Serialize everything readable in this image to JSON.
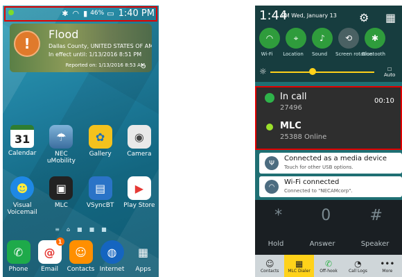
{
  "left_phone": {
    "status": {
      "battery": "46%",
      "time": "1:40 PM",
      "signal_icons": [
        "bluetooth-icon",
        "wifi-icon",
        "signal-icon",
        "battery-icon"
      ]
    },
    "weather": {
      "title": "Flood",
      "location": "Dallas County, UNITED STATES OF AMERICA",
      "in_effect": "In effect until: 1/13/2016 8:51 PM",
      "reported": "Reported on: 1/13/2016 8:53 AM"
    },
    "apps_row1": [
      "Calendar",
      "NEC uMobility",
      "Gallery",
      "Camera"
    ],
    "apps_row2": [
      "Visual Voicemail",
      "MLC",
      "VSyncBT",
      "Play Store"
    ],
    "dock": [
      "Phone",
      "Email",
      "Contacts",
      "Internet",
      "Apps"
    ],
    "calendar_day": "31",
    "email_badge": "1"
  },
  "right_phone": {
    "header": {
      "time": "1:44",
      "ampm": "PM",
      "date": "Wed, January 13"
    },
    "toggles": [
      "Wi-Fi",
      "Location",
      "Sound",
      "Screen rotation",
      "Bluetooth"
    ],
    "brightness_auto": "Auto",
    "notifications": {
      "in_call": {
        "title": "In call",
        "number": "27496",
        "timer": "00:10"
      },
      "mlc": {
        "title": "MLC",
        "subtitle": "25388 Online"
      },
      "usb": {
        "title": "Connected as a media device",
        "subtitle": "Touch for other USB options."
      },
      "wifi": {
        "title": "Wi-Fi connected",
        "subtitle": "Connected to \"NECAMcorp\"."
      }
    },
    "dialer": {
      "keys": [
        "*",
        "0",
        "#"
      ],
      "buttons": [
        "Hold",
        "Answer",
        "Speaker"
      ],
      "tabs": [
        "Contacts",
        "MLC Dialer",
        "Off-hook",
        "Call Logs",
        "More"
      ]
    },
    "accent": "#ffd21a"
  }
}
